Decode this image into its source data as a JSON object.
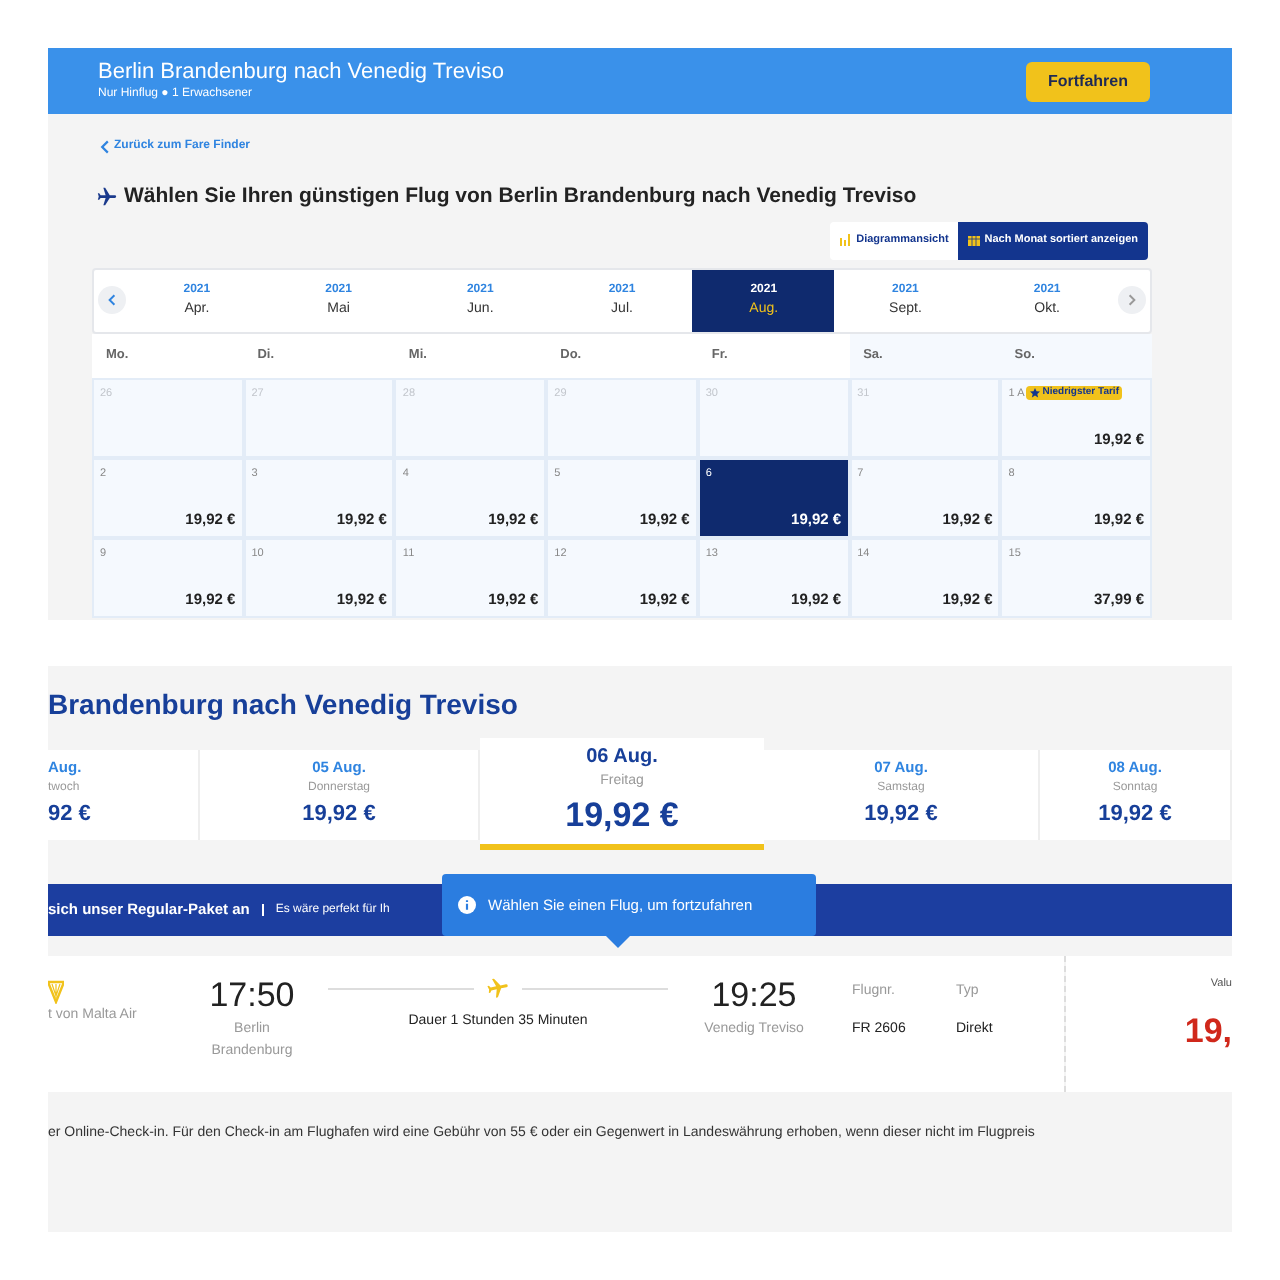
{
  "top": {
    "header": {
      "title": "Berlin Brandenburg nach Venedig Treviso",
      "subtitle": "Nur Hinflug ● 1 Erwachsener",
      "button": "Fortfahren"
    },
    "back_link": "Zurück zum Fare Finder",
    "heading": "Wählen Sie Ihren günstigen Flug von Berlin Brandenburg nach Venedig Treviso",
    "view_buttons": [
      {
        "label": "Diagrammansicht",
        "selected": false
      },
      {
        "label": "Nach Monat sortiert anzeigen",
        "selected": true
      }
    ],
    "months": [
      {
        "year": "2021",
        "month": "Apr.",
        "selected": false
      },
      {
        "year": "2021",
        "month": "Mai",
        "selected": false
      },
      {
        "year": "2021",
        "month": "Jun.",
        "selected": false
      },
      {
        "year": "2021",
        "month": "Jul.",
        "selected": false
      },
      {
        "year": "2021",
        "month": "Aug.",
        "selected": true
      },
      {
        "year": "2021",
        "month": "Sept.",
        "selected": false
      },
      {
        "year": "2021",
        "month": "Okt.",
        "selected": false
      }
    ],
    "weekdays": [
      "Mo.",
      "Di.",
      "Mi.",
      "Do.",
      "Fr.",
      "Sa.",
      "So."
    ],
    "weeks": [
      [
        {
          "day": "26",
          "muted": true,
          "selected": false
        },
        {
          "day": "27",
          "muted": true,
          "selected": false
        },
        {
          "day": "28",
          "muted": true,
          "selected": false
        },
        {
          "day": "29",
          "muted": true,
          "selected": false
        },
        {
          "day": "30",
          "muted": true,
          "selected": false
        },
        {
          "day": "31",
          "muted": true,
          "selected": false
        },
        {
          "day": "1 A",
          "price": "19,92 €",
          "badge": "Niedrigster Tarif",
          "muted": false,
          "selected": false
        }
      ],
      [
        {
          "day": "2",
          "price": "19,92 €",
          "muted": false,
          "selected": false
        },
        {
          "day": "3",
          "price": "19,92 €",
          "muted": false,
          "selected": false
        },
        {
          "day": "4",
          "price": "19,92 €",
          "muted": false,
          "selected": false
        },
        {
          "day": "5",
          "price": "19,92 €",
          "muted": false,
          "selected": false
        },
        {
          "day": "6",
          "price": "19,92 €",
          "muted": false,
          "selected": true
        },
        {
          "day": "7",
          "price": "19,92 €",
          "muted": false,
          "selected": false
        },
        {
          "day": "8",
          "price": "19,92 €",
          "muted": false,
          "selected": false
        }
      ],
      [
        {
          "day": "9",
          "price": "19,92 €",
          "muted": false,
          "selected": false
        },
        {
          "day": "10",
          "price": "19,92 €",
          "muted": false,
          "selected": false
        },
        {
          "day": "11",
          "price": "19,92 €",
          "muted": false,
          "selected": false
        },
        {
          "day": "12",
          "price": "19,92 €",
          "muted": false,
          "selected": false
        },
        {
          "day": "13",
          "price": "19,92 €",
          "muted": false,
          "selected": false
        },
        {
          "day": "14",
          "price": "19,92 €",
          "muted": false,
          "selected": false
        },
        {
          "day": "15",
          "price": "37,99 €",
          "muted": false,
          "selected": false
        }
      ]
    ]
  },
  "bottom": {
    "title": "Brandenburg nach Venedig Treviso",
    "days": [
      {
        "date": "Aug.",
        "weekday": "twoch",
        "price": "92 €",
        "selected": false
      },
      {
        "date": "05 Aug.",
        "weekday": "Donnerstag",
        "price": "19,92 €",
        "selected": false
      },
      {
        "date": "06 Aug.",
        "weekday": "Freitag",
        "price": "19,92 €",
        "selected": true
      },
      {
        "date": "07 Aug.",
        "weekday": "Samstag",
        "price": "19,92 €",
        "selected": false
      },
      {
        "date": "08 Aug.",
        "weekday": "Sonntag",
        "price": "19,92 €",
        "selected": false
      }
    ],
    "banner": {
      "title": "sich unser Regular-Paket an",
      "text": "Es wäre perfekt für Ih"
    },
    "tooltip": "Wählen Sie einen Flug, um fortzufahren",
    "flight": {
      "operator": "t von Malta Air",
      "departure_time": "17:50",
      "departure_place": "Berlin Brandenburg",
      "duration": "Dauer 1 Stunden 35 Minuten",
      "arrival_time": "19:25",
      "arrival_place": "Venedig Treviso",
      "flight_no_label": "Flugnr.",
      "flight_no": "FR 2606",
      "type_label": "Typ",
      "type": "Direkt",
      "fare_label": "Valu",
      "fare_price": "19,"
    },
    "note": "er Online-Check-in. Für den Check-in am Flughafen wird eine Gebühr von 55 € oder ein Gegenwert in Landeswährung erhoben, wenn dieser nicht im Flugpreis"
  }
}
